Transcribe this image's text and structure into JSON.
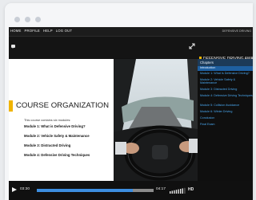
{
  "nav": {
    "items": [
      "HOME",
      "PROFILE",
      "HELP",
      "LOG OUT"
    ],
    "course_name": "DEFENSIVE DRIVING"
  },
  "banner": {
    "title": "DEFENSIVE DRIVING AWARENESS"
  },
  "slide": {
    "title": "COURSE ORGANIZATION",
    "intro": "This course contains six modules:",
    "modules": [
      "Module 1: What is Defensive Driving?",
      "Module 2: Vehicle Safety & Maintenance",
      "Module 3: Distracted Driving",
      "Module 4: Defensive Driving Techniques"
    ]
  },
  "sidebar": {
    "header": "Chapters",
    "chapters": [
      "Introduction",
      "Module 1: What Is Defensive Driving?",
      "Module 2: Vehicle Safety & Maintenance",
      "Module 3: Distracted Driving",
      "Module 4: Defensive Driving Techniques",
      "Module 5: Collision Avoidance",
      "Module 6: Winter Driving",
      "Conclusion",
      "Final Exam"
    ],
    "active_index": 0
  },
  "player": {
    "current_time": "03:30",
    "total_time": "04:17",
    "hd_label": "HD",
    "progress_fraction": 0.82,
    "volume_level": 0.8
  },
  "colors": {
    "accent": "#f0b400",
    "progress": "#3d8ee0",
    "chapter_link": "#4aa8f0",
    "chapter_active": "#1e5fa0"
  }
}
